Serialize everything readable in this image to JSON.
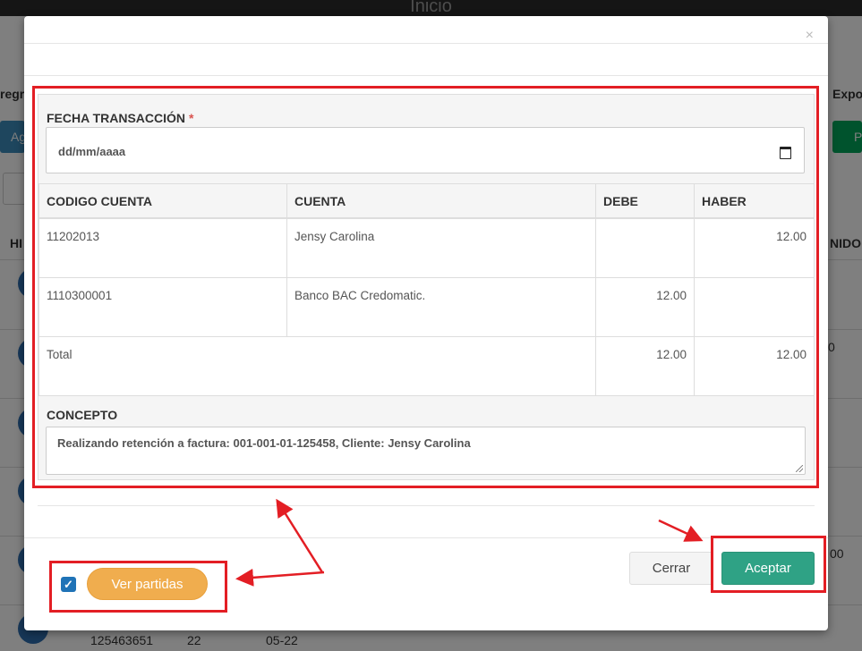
{
  "background": {
    "page_title": "Inicio",
    "left_partial_text": "regre",
    "right_partial_text": "Expo",
    "left_button_partial": "Ag",
    "right_button_partial": "P",
    "col_left_partial": "HI",
    "col_right_partial": "NIDO",
    "bottom_row": {
      "code": "125463651",
      "num": "22",
      "date": "05-22"
    },
    "right_values": [
      "0",
      "00"
    ]
  },
  "modal": {
    "close_symbol": "×",
    "fecha_label": "FECHA TRANSACCIÓN",
    "required_mark": "*",
    "date_placeholder": "dd/mm/aaaa",
    "table": {
      "headers": [
        "CODIGO CUENTA",
        "CUENTA",
        "DEBE",
        "HABER"
      ],
      "rows": [
        {
          "codigo": "11202013",
          "cuenta": "Jensy Carolina",
          "debe": "",
          "haber": "12.00"
        },
        {
          "codigo": "1110300001",
          "cuenta": "Banco BAC Credomatic.",
          "debe": "12.00",
          "haber": ""
        }
      ],
      "total": {
        "label": "Total",
        "debe": "12.00",
        "haber": "12.00"
      }
    },
    "concepto_label": "CONCEPTO",
    "concepto_value": "Realizando retención a factura: 001-001-01-125458, Cliente: Jensy Carolina",
    "ver_partidas_checked": true,
    "ver_partidas_label": "Ver partidas",
    "cerrar_label": "Cerrar",
    "aceptar_label": "Aceptar"
  },
  "colors": {
    "annotation_red": "#e31e24",
    "aceptar_green": "#2fa285",
    "partidas_orange": "#f0ad4e",
    "checkbox_blue": "#1f73b7"
  }
}
